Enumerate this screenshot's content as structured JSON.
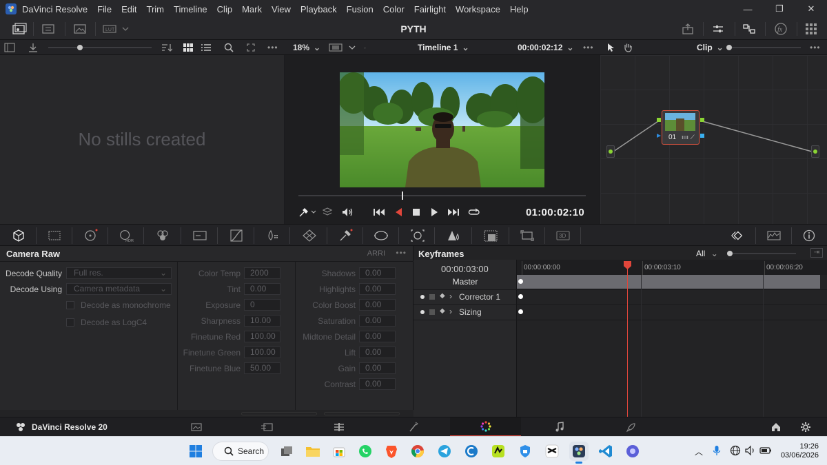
{
  "title_bar": {
    "app_name": "DaVinci Resolve",
    "menu": [
      "File",
      "Edit",
      "Trim",
      "Timeline",
      "Clip",
      "Mark",
      "View",
      "Playback",
      "Fusion",
      "Color",
      "Fairlight",
      "Workspace",
      "Help"
    ]
  },
  "header": {
    "project_name": "PYTH"
  },
  "toolbar": {
    "zoom": "18%",
    "timeline_name": "Timeline 1",
    "timeline_tc": "00:00:02:12",
    "node_mode": "Clip"
  },
  "gallery": {
    "empty_text": "No stills created"
  },
  "viewer": {
    "timecode": "01:00:02:10"
  },
  "nodes": {
    "node_label": "01"
  },
  "camera_raw": {
    "title": "Camera Raw",
    "camera": "ARRI",
    "decode_quality_label": "Decode Quality",
    "decode_quality_value": "Full res.",
    "decode_using_label": "Decode Using",
    "decode_using_value": "Camera metadata",
    "mono_label": "Decode as monochrome",
    "logc_label": "Decode as LogC4",
    "col1": [
      {
        "label": "Color Temp",
        "value": "2000"
      },
      {
        "label": "Tint",
        "value": "0.00"
      },
      {
        "label": "Exposure",
        "value": "0"
      },
      {
        "label": "Sharpness",
        "value": "10.00"
      },
      {
        "label": "Finetune Red",
        "value": "100.00"
      },
      {
        "label": "Finetune Green",
        "value": "100.00"
      },
      {
        "label": "Finetune Blue",
        "value": "50.00"
      }
    ],
    "col2": [
      {
        "label": "Shadows",
        "value": "0.00"
      },
      {
        "label": "Highlights",
        "value": "0.00"
      },
      {
        "label": "Color Boost",
        "value": "0.00"
      },
      {
        "label": "Saturation",
        "value": "0.00"
      },
      {
        "label": "Midtone Detail",
        "value": "0.00"
      },
      {
        "label": "Lift",
        "value": "0.00"
      },
      {
        "label": "Gain",
        "value": "0.00"
      },
      {
        "label": "Contrast",
        "value": "0.00"
      }
    ]
  },
  "keyframes": {
    "title": "Keyframes",
    "filter": "All",
    "current_tc": "00:00:03:00",
    "ruler": [
      "00:00:00:00",
      "00:00:03:10",
      "00:00:06:20"
    ],
    "tracks": [
      "Master",
      "Corrector 1",
      "Sizing"
    ]
  },
  "page_bar": {
    "app_label": "DaVinci Resolve 20"
  },
  "taskbar": {
    "search": "Search",
    "time": "19:26",
    "date": "03/06/2026"
  }
}
